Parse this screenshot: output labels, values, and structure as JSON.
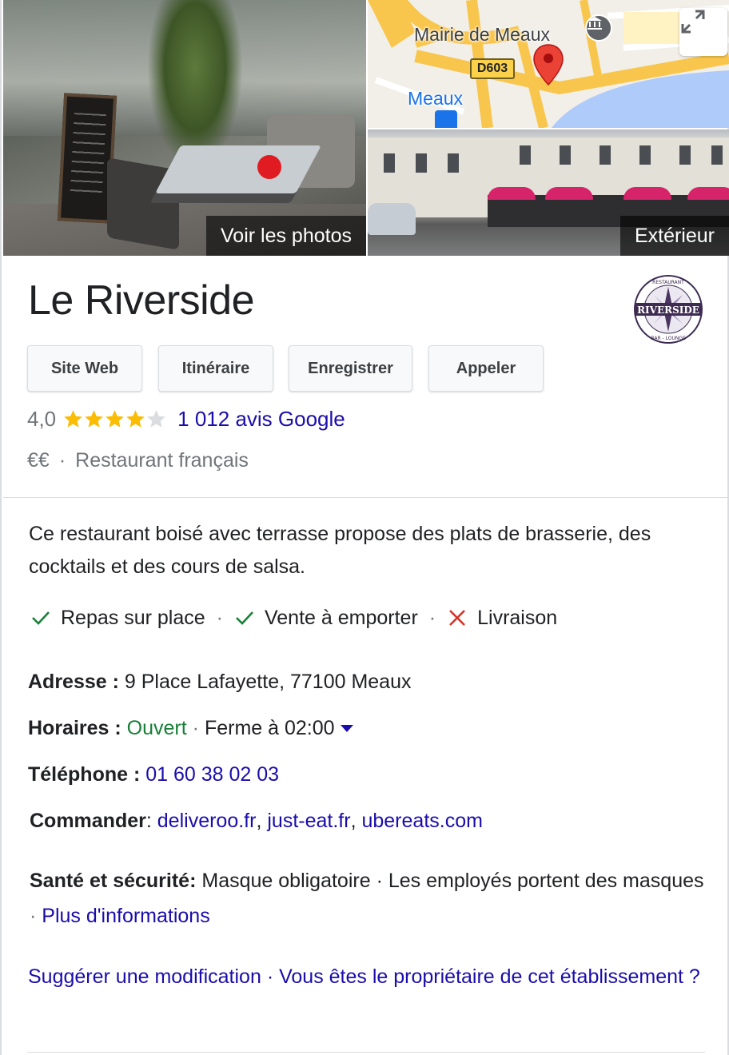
{
  "photos": {
    "main_label": "Voir les photos",
    "exterior_label": "Extérieur"
  },
  "map": {
    "labels": {
      "mairie": "Mairie de Meaux",
      "road": "D603",
      "city": "Meaux"
    },
    "pin_color": "#ea4335",
    "water_color": "#aecbfa",
    "road_color": "#f9c64d"
  },
  "place": {
    "name": "Le Riverside",
    "logo_text": "RIVERSIDE",
    "logo_top": "RESTAURANT",
    "logo_bottom": "BAR - LOUNGE"
  },
  "actions": [
    {
      "label": "Site Web"
    },
    {
      "label": "Itinéraire"
    },
    {
      "label": "Enregistrer"
    },
    {
      "label": "Appeler"
    }
  ],
  "rating": {
    "value_text": "4,0",
    "stars_filled": 4,
    "stars_total": 5,
    "reviews_link": "1 012 avis Google",
    "star_color": "#fbbc04",
    "star_empty_color": "#dadce0"
  },
  "meta": {
    "price": "€€",
    "separator": "·",
    "category": "Restaurant français"
  },
  "description": "Ce restaurant boisé avec terrasse propose des plats de brasserie, des cocktails et des cours de salsa.",
  "services": [
    {
      "label": "Repas sur place",
      "available": true,
      "icon": "check-icon"
    },
    {
      "label": "Vente à emporter",
      "available": true,
      "icon": "check-icon"
    },
    {
      "label": "Livraison",
      "available": false,
      "icon": "cross-icon"
    }
  ],
  "services_separator": "·",
  "address": {
    "label": "Adresse :",
    "value": "9 Place Lafayette, 77100 Meaux"
  },
  "hours": {
    "label": "Horaires :",
    "status": "Ouvert",
    "separator": "·",
    "detail": "Ferme à 02:00"
  },
  "phone": {
    "label": "Téléphone :",
    "value": "01 60 38 02 03"
  },
  "order": {
    "label": "Commander",
    "colon": ":",
    "links": [
      "deliveroo.fr",
      "just-eat.fr",
      "ubereats.com"
    ],
    "comma": ","
  },
  "health": {
    "label": "Santé et sécurité:",
    "items": "Masque obligatoire · Les employés portent des masques",
    "separator": "·",
    "more_link": "Plus d'informations"
  },
  "footer": {
    "suggest_link": "Suggérer une modification",
    "separator": "·",
    "owner_link": "Vous êtes le propriétaire de cet établissement ?"
  }
}
